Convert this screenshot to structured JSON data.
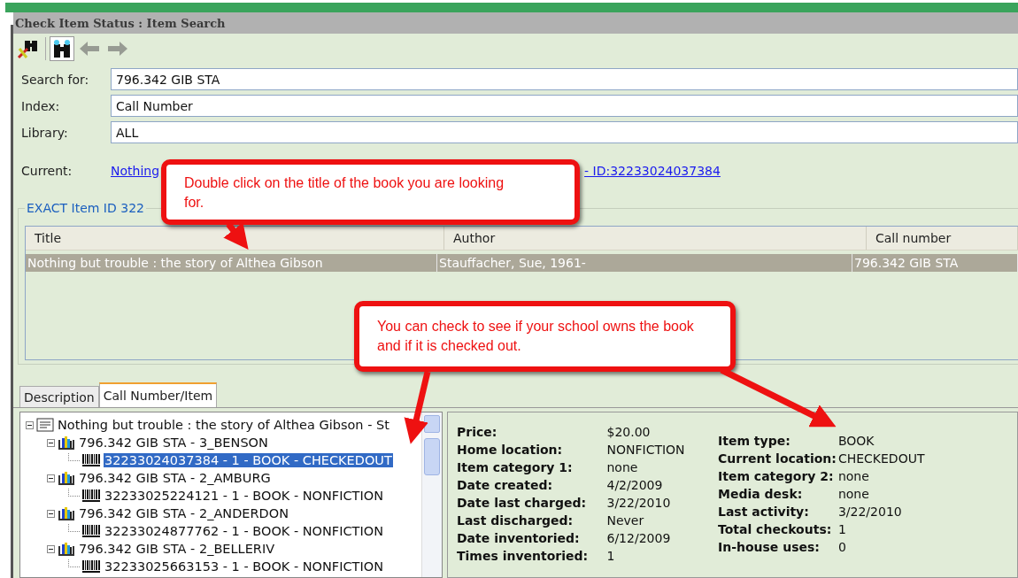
{
  "window": {
    "title": "Check Item Status : Item Search"
  },
  "toolbar": [
    {
      "kind": "wrench-binoculars",
      "selected": false,
      "disabled": false
    },
    {
      "kind": "binoculars",
      "selected": true,
      "disabled": false
    },
    {
      "kind": "back",
      "selected": false,
      "disabled": true
    },
    {
      "kind": "forward",
      "selected": false,
      "disabled": true
    }
  ],
  "form": {
    "fields": [
      {
        "label": "Search for:",
        "value": "796.342 GIB STA"
      },
      {
        "label": "Index:",
        "value": "Call Number"
      },
      {
        "label": "Library:",
        "value": "ALL"
      }
    ],
    "current": {
      "label": "Current:",
      "link_start": "Nothing",
      "link_end": "- ID:32233024037384"
    }
  },
  "results": {
    "group_title": "EXACT Item ID 322",
    "columns": [
      "Title",
      "Author",
      "Call number"
    ],
    "rows": [
      {
        "cells": [
          "Nothing but trouble : the story of Althea Gibson",
          "Stauffacher, Sue, 1961-",
          "796.342 GIB STA"
        ],
        "selected": true
      }
    ]
  },
  "tabs": [
    {
      "label": "Description",
      "selected": false
    },
    {
      "label": "Call Number/Item",
      "selected": true
    }
  ],
  "tree": [
    {
      "kind": "title",
      "label": "Nothing but trouble : the story of Althea Gibson - St",
      "expanded": true,
      "selected": false,
      "children": [
        {
          "kind": "callnumber",
          "label": "796.342 GIB STA - 3_BENSON",
          "expanded": true,
          "selected": false,
          "children": [
            {
              "kind": "item",
              "label": "32233024037384 - 1 - BOOK - CHECKEDOUT",
              "selected": true
            }
          ]
        },
        {
          "kind": "callnumber",
          "label": "796.342 GIB STA - 2_AMBURG",
          "expanded": true,
          "selected": false,
          "children": [
            {
              "kind": "item",
              "label": "32233025224121 - 1 - BOOK - NONFICTION",
              "selected": false
            }
          ]
        },
        {
          "kind": "callnumber",
          "label": "796.342 GIB STA - 2_ANDERDON",
          "expanded": true,
          "selected": false,
          "children": [
            {
              "kind": "item",
              "label": "32233024877762 - 1 - BOOK - NONFICTION",
              "selected": false
            }
          ]
        },
        {
          "kind": "callnumber",
          "label": "796.342 GIB STA - 2_BELLERIV",
          "expanded": true,
          "selected": false,
          "children": [
            {
              "kind": "item",
              "label": "32233025663153 - 1 - BOOK - NONFICTION",
              "selected": false
            }
          ]
        }
      ]
    }
  ],
  "details": {
    "columns": [
      [
        {
          "label": "Price:",
          "value": "$20.00"
        },
        {
          "label": "Home location:",
          "value": "NONFICTION"
        },
        {
          "label": "Item category 1:",
          "value": "none"
        },
        {
          "label": "Date created:",
          "value": "4/2/2009"
        },
        {
          "label": "Date last charged:",
          "value": "3/22/2010"
        },
        {
          "label": "Last discharged:",
          "value": "Never"
        },
        {
          "label": "Date inventoried:",
          "value": "6/12/2009"
        },
        {
          "label": "Times inventoried:",
          "value": "1"
        }
      ],
      [
        {
          "label": "Item type:",
          "value": "BOOK"
        },
        {
          "label": "Current location:",
          "value": "CHECKEDOUT"
        },
        {
          "label": "Item category 2:",
          "value": "none"
        },
        {
          "label": "Media desk:",
          "value": "none"
        },
        {
          "label": "Last activity:",
          "value": "3/22/2010"
        },
        {
          "label": "Total checkouts:",
          "value": "1"
        },
        {
          "label": "In-house uses:",
          "value": "0"
        }
      ]
    ]
  },
  "callouts": [
    {
      "text": "Double click on the title of the book you are looking for."
    },
    {
      "text": "You can check to see if your school owns the book and if it is checked out."
    }
  ]
}
